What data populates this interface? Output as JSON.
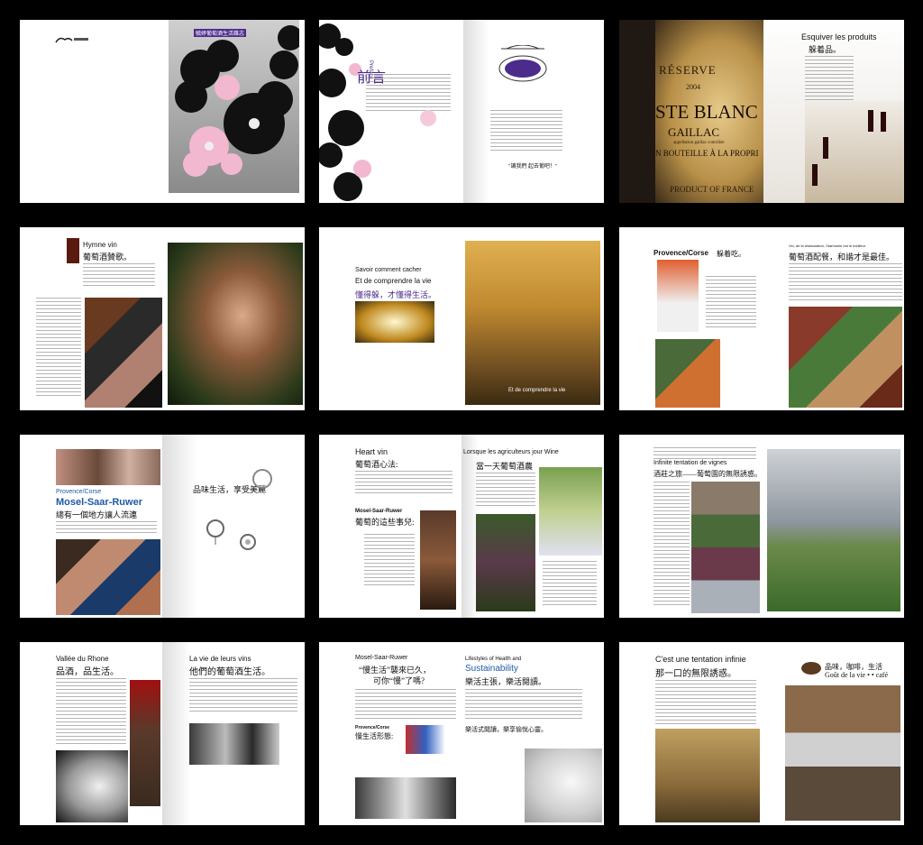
{
  "spreads": [
    {
      "id": 1,
      "texts": {
        "banner": "毓婷葡萄酒生活雜志"
      }
    },
    {
      "id": 2,
      "texts": {
        "preface_zh": "前言",
        "preface_en": "Preface",
        "quote": "\"讓我們   起去葡吧！\""
      }
    },
    {
      "id": 3,
      "texts": {
        "label_reserve": "RÉSERVE",
        "label_year": "2004",
        "label_name": "STE BLANC",
        "label_region": "GAILLAC",
        "label_sub": "appellation gaillac contrôlée",
        "label_bottle": "N BOUTEILLE À LA PROPRI",
        "label_france": "PRODUCT OF FRANCE",
        "title_fr": "Esquiver les produits",
        "title_zh": "躲着品。"
      }
    },
    {
      "id": 4,
      "texts": {
        "title_fr": "Hymne vin",
        "title_zh": "葡萄酒贊歌。"
      }
    },
    {
      "id": 5,
      "texts": {
        "title_fr1": "Savoir comment cacher",
        "title_fr2": "Et de comprendre la vie",
        "title_zh": "懂得躲，才懂得生活。",
        "caption": "Et de comprendre la vie"
      }
    },
    {
      "id": 6,
      "texts": {
        "title_fr": "Provence/Corse",
        "title_zh": "躲着吃。",
        "right_fr": "Vin, de la restauration, l'harmonie est le meilleur",
        "right_zh": "葡萄酒配餐，和諧才是最佳。"
      }
    },
    {
      "id": 7,
      "texts": {
        "title_fr": "Provence/Corse",
        "title_big": "Mosel-Saar-Ruwer",
        "title_zh": "總有一個地方讓人流連",
        "right_zh": "品味生活，享受美麗"
      }
    },
    {
      "id": 8,
      "texts": {
        "title_fr": "Heart vin",
        "title_zh": "葡萄酒心法:",
        "sub_fr": "Mosel-Saar-Ruwer",
        "sub_zh": "葡萄的這些事兒:",
        "right_fr": "Lorsque les agriculteurs jour Wine",
        "right_zh": "當一天葡萄酒農"
      }
    },
    {
      "id": 9,
      "texts": {
        "title_fr": "Infinite tentation de vignes",
        "title_zh": "酒莊之旅——葡萄園的無限誘惑。"
      }
    },
    {
      "id": 10,
      "texts": {
        "title_fr": "Vallée du Rhone",
        "title_zh": "品酒，品生活。",
        "right_fr": "La vie de leurs vins",
        "right_zh": "他們的葡萄酒生活。"
      }
    },
    {
      "id": 11,
      "texts": {
        "title_fr": "Mosel-Saar-Ruwer",
        "title_zh1": "“慢生活”襲來已久，",
        "title_zh2": "可你“慢”了嗎?",
        "sub_fr": "Provence/Corse",
        "sub_zh": "慢生活形態:",
        "right_fr1": "Lifestyles of Health and",
        "right_fr2": "Sustainability",
        "right_zh": "樂活主張，樂活閱讀。",
        "right_zh2": "樂活式閱讀，樂享愉悅心靈。"
      }
    },
    {
      "id": 12,
      "texts": {
        "title_fr": "C'est une tentation infinie",
        "title_zh": "那一口的無限誘惑。",
        "right_zh": "品味，咖啡，生活",
        "right_fr": "Goût de la vie • • café"
      }
    }
  ],
  "colors": {
    "purple": "#4b2b8c",
    "blue": "#1e5aa8",
    "pink": "#f2b8cf",
    "black": "#111111"
  }
}
